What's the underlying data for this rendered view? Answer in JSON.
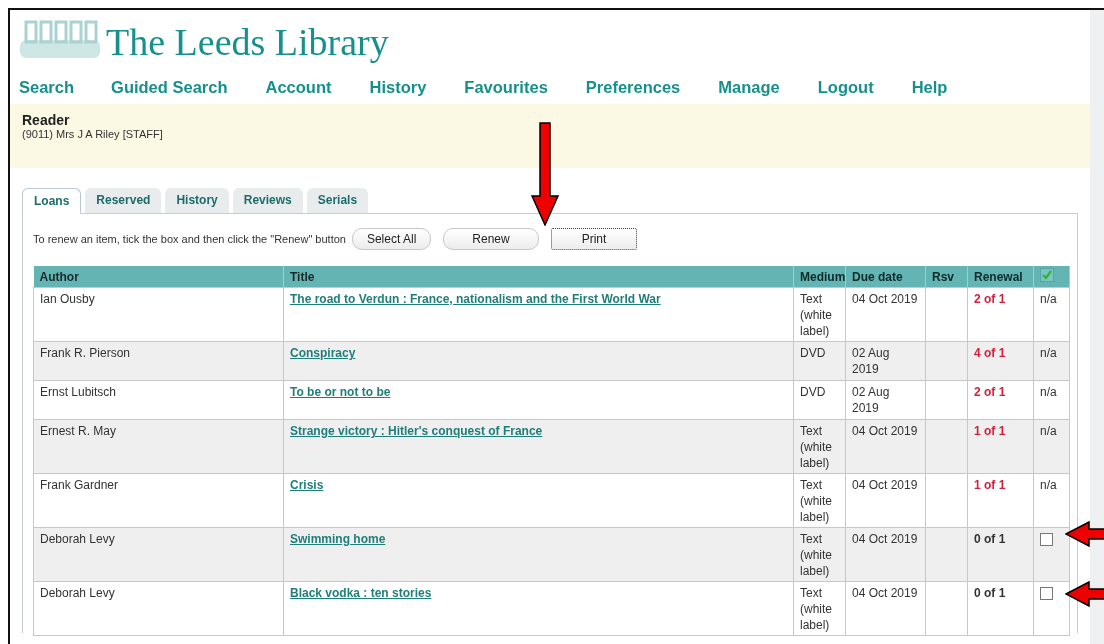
{
  "site": {
    "title": "The Leeds Library"
  },
  "nav": [
    "Search",
    "Guided Search",
    "Account",
    "History",
    "Favourites",
    "Preferences",
    "Manage",
    "Logout",
    "Help"
  ],
  "reader": {
    "heading": "Reader",
    "name": "(9011) Mrs J A Riley [STAFF]"
  },
  "tabs": [
    {
      "label": "Loans",
      "selected": true
    },
    {
      "label": "Reserved",
      "selected": false
    },
    {
      "label": "History",
      "selected": false
    },
    {
      "label": "Reviews",
      "selected": false
    },
    {
      "label": "Serials",
      "selected": false
    }
  ],
  "instructions": "To renew an item, tick the box and then click the \"Renew\" button",
  "buttons": [
    {
      "label": "Select All",
      "focused": false
    },
    {
      "label": "Renew",
      "focused": false
    },
    {
      "label": "Print",
      "focused": true
    }
  ],
  "table": {
    "columns": [
      "Author",
      "Title",
      "Medium",
      "Due date",
      "Rsv",
      "Renewal"
    ],
    "rows": [
      {
        "author": "Ian Ousby",
        "title": "The road to Verdun : France, nationalism and the First World War",
        "medium": "Text (white label)",
        "due": "04 Oct 2019",
        "renewal": "2 of 1",
        "over_limit": true,
        "select": {
          "kind": "text",
          "text": "n/a"
        }
      },
      {
        "author": "Frank R. Pierson",
        "title": "Conspiracy",
        "medium": "DVD",
        "due": "02 Aug 2019",
        "renewal": "4 of 1",
        "over_limit": true,
        "select": {
          "kind": "text",
          "text": "n/a"
        }
      },
      {
        "author": "Ernst Lubitsch",
        "title": "To be or not to be",
        "medium": "DVD",
        "due": "02 Aug 2019",
        "renewal": "2 of 1",
        "over_limit": true,
        "select": {
          "kind": "text",
          "text": "n/a"
        }
      },
      {
        "author": "Ernest R. May",
        "title": "Strange victory : Hitler's conquest of France",
        "medium": "Text (white label)",
        "due": "04 Oct 2019",
        "renewal": "1 of 1",
        "over_limit": true,
        "select": {
          "kind": "text",
          "text": "n/a"
        }
      },
      {
        "author": "Frank Gardner",
        "title": "Crisis",
        "medium": "Text (white label)",
        "due": "04 Oct 2019",
        "renewal": "1 of 1",
        "over_limit": true,
        "select": {
          "kind": "text",
          "text": "n/a"
        }
      },
      {
        "author": "Deborah Levy",
        "title": "Swimming home",
        "medium": "Text (white label)",
        "due": "04 Oct 2019",
        "renewal": "0 of 1",
        "over_limit": false,
        "select": {
          "kind": "checkbox",
          "checked": false
        }
      },
      {
        "author": "Deborah Levy",
        "title": "Black vodka : ten stories",
        "medium": "Text (white label)",
        "due": "04 Oct 2019",
        "renewal": "0 of 1",
        "over_limit": false,
        "select": {
          "kind": "checkbox",
          "checked": false
        }
      }
    ]
  }
}
